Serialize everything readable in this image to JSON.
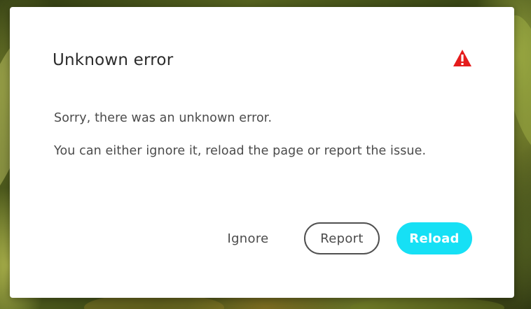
{
  "dialog": {
    "title": "Unknown error",
    "icon": "alert-icon",
    "message_line1": "Sorry, there was an unknown error.",
    "message_line2": "You can either ignore it, reload the page or report the issue."
  },
  "buttons": {
    "ignore_label": "Ignore",
    "report_label": "Report",
    "reload_label": "Reload"
  },
  "colors": {
    "alert": "#e51c1c",
    "reload_bg": "#16e0f5",
    "report_border": "#505050"
  }
}
